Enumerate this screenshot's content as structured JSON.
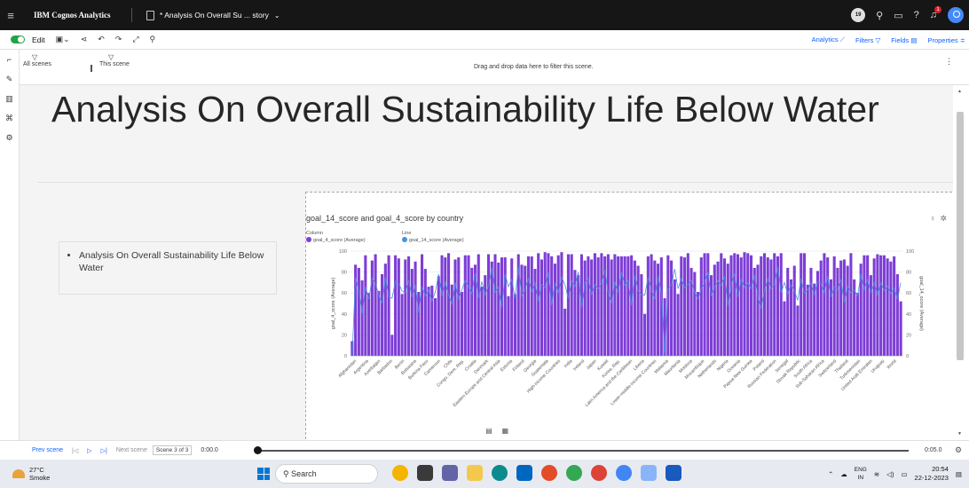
{
  "app": {
    "brand": "IBM Cognos Analytics",
    "doc_title": "* Analysis On Overall Su ... story",
    "notif_count": "19",
    "bell_count": "1"
  },
  "toolbar": {
    "edit_label": "Edit",
    "right_items": [
      "Analytics",
      "Filters",
      "Fields",
      "Properties"
    ]
  },
  "filterbar": {
    "all_scenes": "All scenes",
    "this_scene": "This scene",
    "drop_hint": "Drag and drop data here to filter this scene."
  },
  "canvas": {
    "title": "Analysis On Overall Sustainability Life Below Water",
    "note_bullet": "Analysis On Overall Sustainability Life Below Water"
  },
  "chart": {
    "title": "goal_14_score and goal_4_score by country",
    "legend": {
      "column_header": "Column",
      "column_series": "goal_4_score (Average)",
      "line_header": "Line",
      "line_series": "goal_14_score (Average)"
    },
    "colors": {
      "bar": "#7d3dd6",
      "line": "#4a90e2"
    }
  },
  "chart_data": {
    "type": "bar",
    "title": "goal_14_score and goal_4_score by country",
    "ylabel": "goal_4_score (Average)",
    "y2label": "goal_14_score (Average)",
    "ylim": [
      0,
      100
    ],
    "y2lim": [
      0,
      100
    ],
    "yticks": [
      0,
      20,
      40,
      60,
      80,
      100
    ],
    "shown_tick_labels": [
      "Afghanistan",
      "Argentina",
      "Azerbaijan",
      "Barbados",
      "Benin",
      "Botswana",
      "Burkina Faso",
      "Cameroon",
      "Chile",
      "Congo, Dem. Rep.",
      "Croatia",
      "Denmark",
      "Eastern Europe and Central Asia",
      "Estonia",
      "Finland",
      "Georgia",
      "Guatemala",
      "High-income Countries",
      "India",
      "Ireland",
      "Japan",
      "Kuwait",
      "Korea, Rep.",
      "Latin America and the Caribbean",
      "Liberia",
      "Lower-middle-income Countries",
      "Malaysia",
      "Mauritania",
      "Moldova",
      "Mozambique",
      "Netherlands",
      "Nigeria",
      "Oceania",
      "Papua New Guinea",
      "Poland",
      "Russian Federation",
      "Senegal",
      "Slovak Republic",
      "South Africa",
      "Sub-Saharan Africa",
      "Switzerland",
      "Thailand",
      "Turkmenistan",
      "United Arab Emirates",
      "Uruguay",
      "World"
    ],
    "series": [
      {
        "name": "goal_4_score (Average)",
        "kind": "column",
        "values": [
          14,
          87,
          84,
          72,
          96,
          60,
          91,
          97,
          62,
          78,
          88,
          96,
          20,
          96,
          93,
          59,
          92,
          95,
          83,
          90,
          61,
          97,
          83,
          66,
          67,
          55,
          76,
          96,
          94,
          98,
          68,
          92,
          94,
          61,
          96,
          96,
          84,
          87,
          97,
          66,
          77,
          97,
          90,
          97,
          89,
          94,
          94,
          57,
          93,
          59,
          97,
          87,
          86,
          95,
          95,
          83,
          98,
          92,
          99,
          98,
          95,
          88,
          96,
          99,
          45,
          97,
          97,
          82,
          77,
          97,
          91,
          95,
          92,
          98,
          94,
          98,
          95,
          97,
          92,
          97,
          95,
          95,
          95,
          95,
          96,
          91,
          86,
          78,
          40,
          95,
          97,
          91,
          88,
          94,
          55,
          96,
          91,
          73,
          59,
          95,
          94,
          98,
          84,
          80,
          61,
          94,
          98,
          98,
          77,
          87,
          90,
          98,
          93,
          88,
          96,
          98,
          97,
          94,
          99,
          98,
          96,
          84,
          87,
          95,
          98,
          94,
          92,
          98,
          95,
          98,
          52,
          84,
          73,
          86,
          48,
          98,
          98,
          68,
          84,
          69,
          81,
          91,
          98,
          94,
          73,
          95,
          84,
          91,
          92,
          86,
          98,
          73,
          60,
          88,
          96,
          96,
          77,
          93,
          97,
          96,
          96,
          93,
          90,
          95,
          78,
          52
        ]
      },
      {
        "name": "goal_14_score (Average)",
        "kind": "line",
        "values": [
          0,
          75,
          62,
          40,
          66,
          54,
          74,
          69,
          58,
          50,
          75,
          56,
          55,
          71,
          69,
          62,
          60,
          72,
          56,
          68,
          41,
          66,
          57,
          63,
          52,
          61,
          78,
          57,
          71,
          58,
          49,
          70,
          54,
          63,
          72,
          66,
          59,
          79,
          55,
          71,
          58,
          67,
          84,
          60,
          66,
          46,
          78,
          66,
          73,
          55,
          85,
          57,
          63,
          74,
          61,
          70,
          52,
          68,
          65,
          80,
          48,
          70,
          60,
          75,
          68,
          55,
          72,
          66,
          80,
          46,
          70,
          74,
          58,
          68,
          64,
          69,
          82,
          60,
          50,
          71,
          60,
          80,
          67,
          72,
          48,
          77,
          62,
          58,
          58,
          75,
          63,
          54,
          76,
          60,
          0,
          64,
          67,
          83,
          64,
          74,
          65,
          68,
          72,
          61,
          54,
          64,
          70,
          80,
          57,
          66,
          72,
          67,
          76,
          48,
          67,
          79,
          56,
          73,
          65,
          70,
          64,
          77,
          57,
          45,
          62,
          74,
          64,
          68,
          85,
          60,
          70,
          59,
          68,
          62,
          53,
          74,
          60,
          63,
          70,
          58,
          71,
          69,
          60,
          76,
          56,
          66,
          63,
          73,
          51,
          67,
          60,
          63,
          57,
          78,
          63,
          73,
          60,
          70,
          58,
          70,
          62,
          67,
          59,
          65,
          54,
          70
        ]
      }
    ]
  },
  "scenebar": {
    "prev": "Prev scene",
    "next": "Next scene",
    "scene_pos": "Scene 3 of 3",
    "time_start": "0:00.0",
    "time_end": "0:05.0"
  },
  "taskbar": {
    "temp": "27°C",
    "weather": "Smoke",
    "search": "Search",
    "lang_top": "ENG",
    "lang_bottom": "IN",
    "time": "20:54",
    "date": "22-12-2023"
  }
}
